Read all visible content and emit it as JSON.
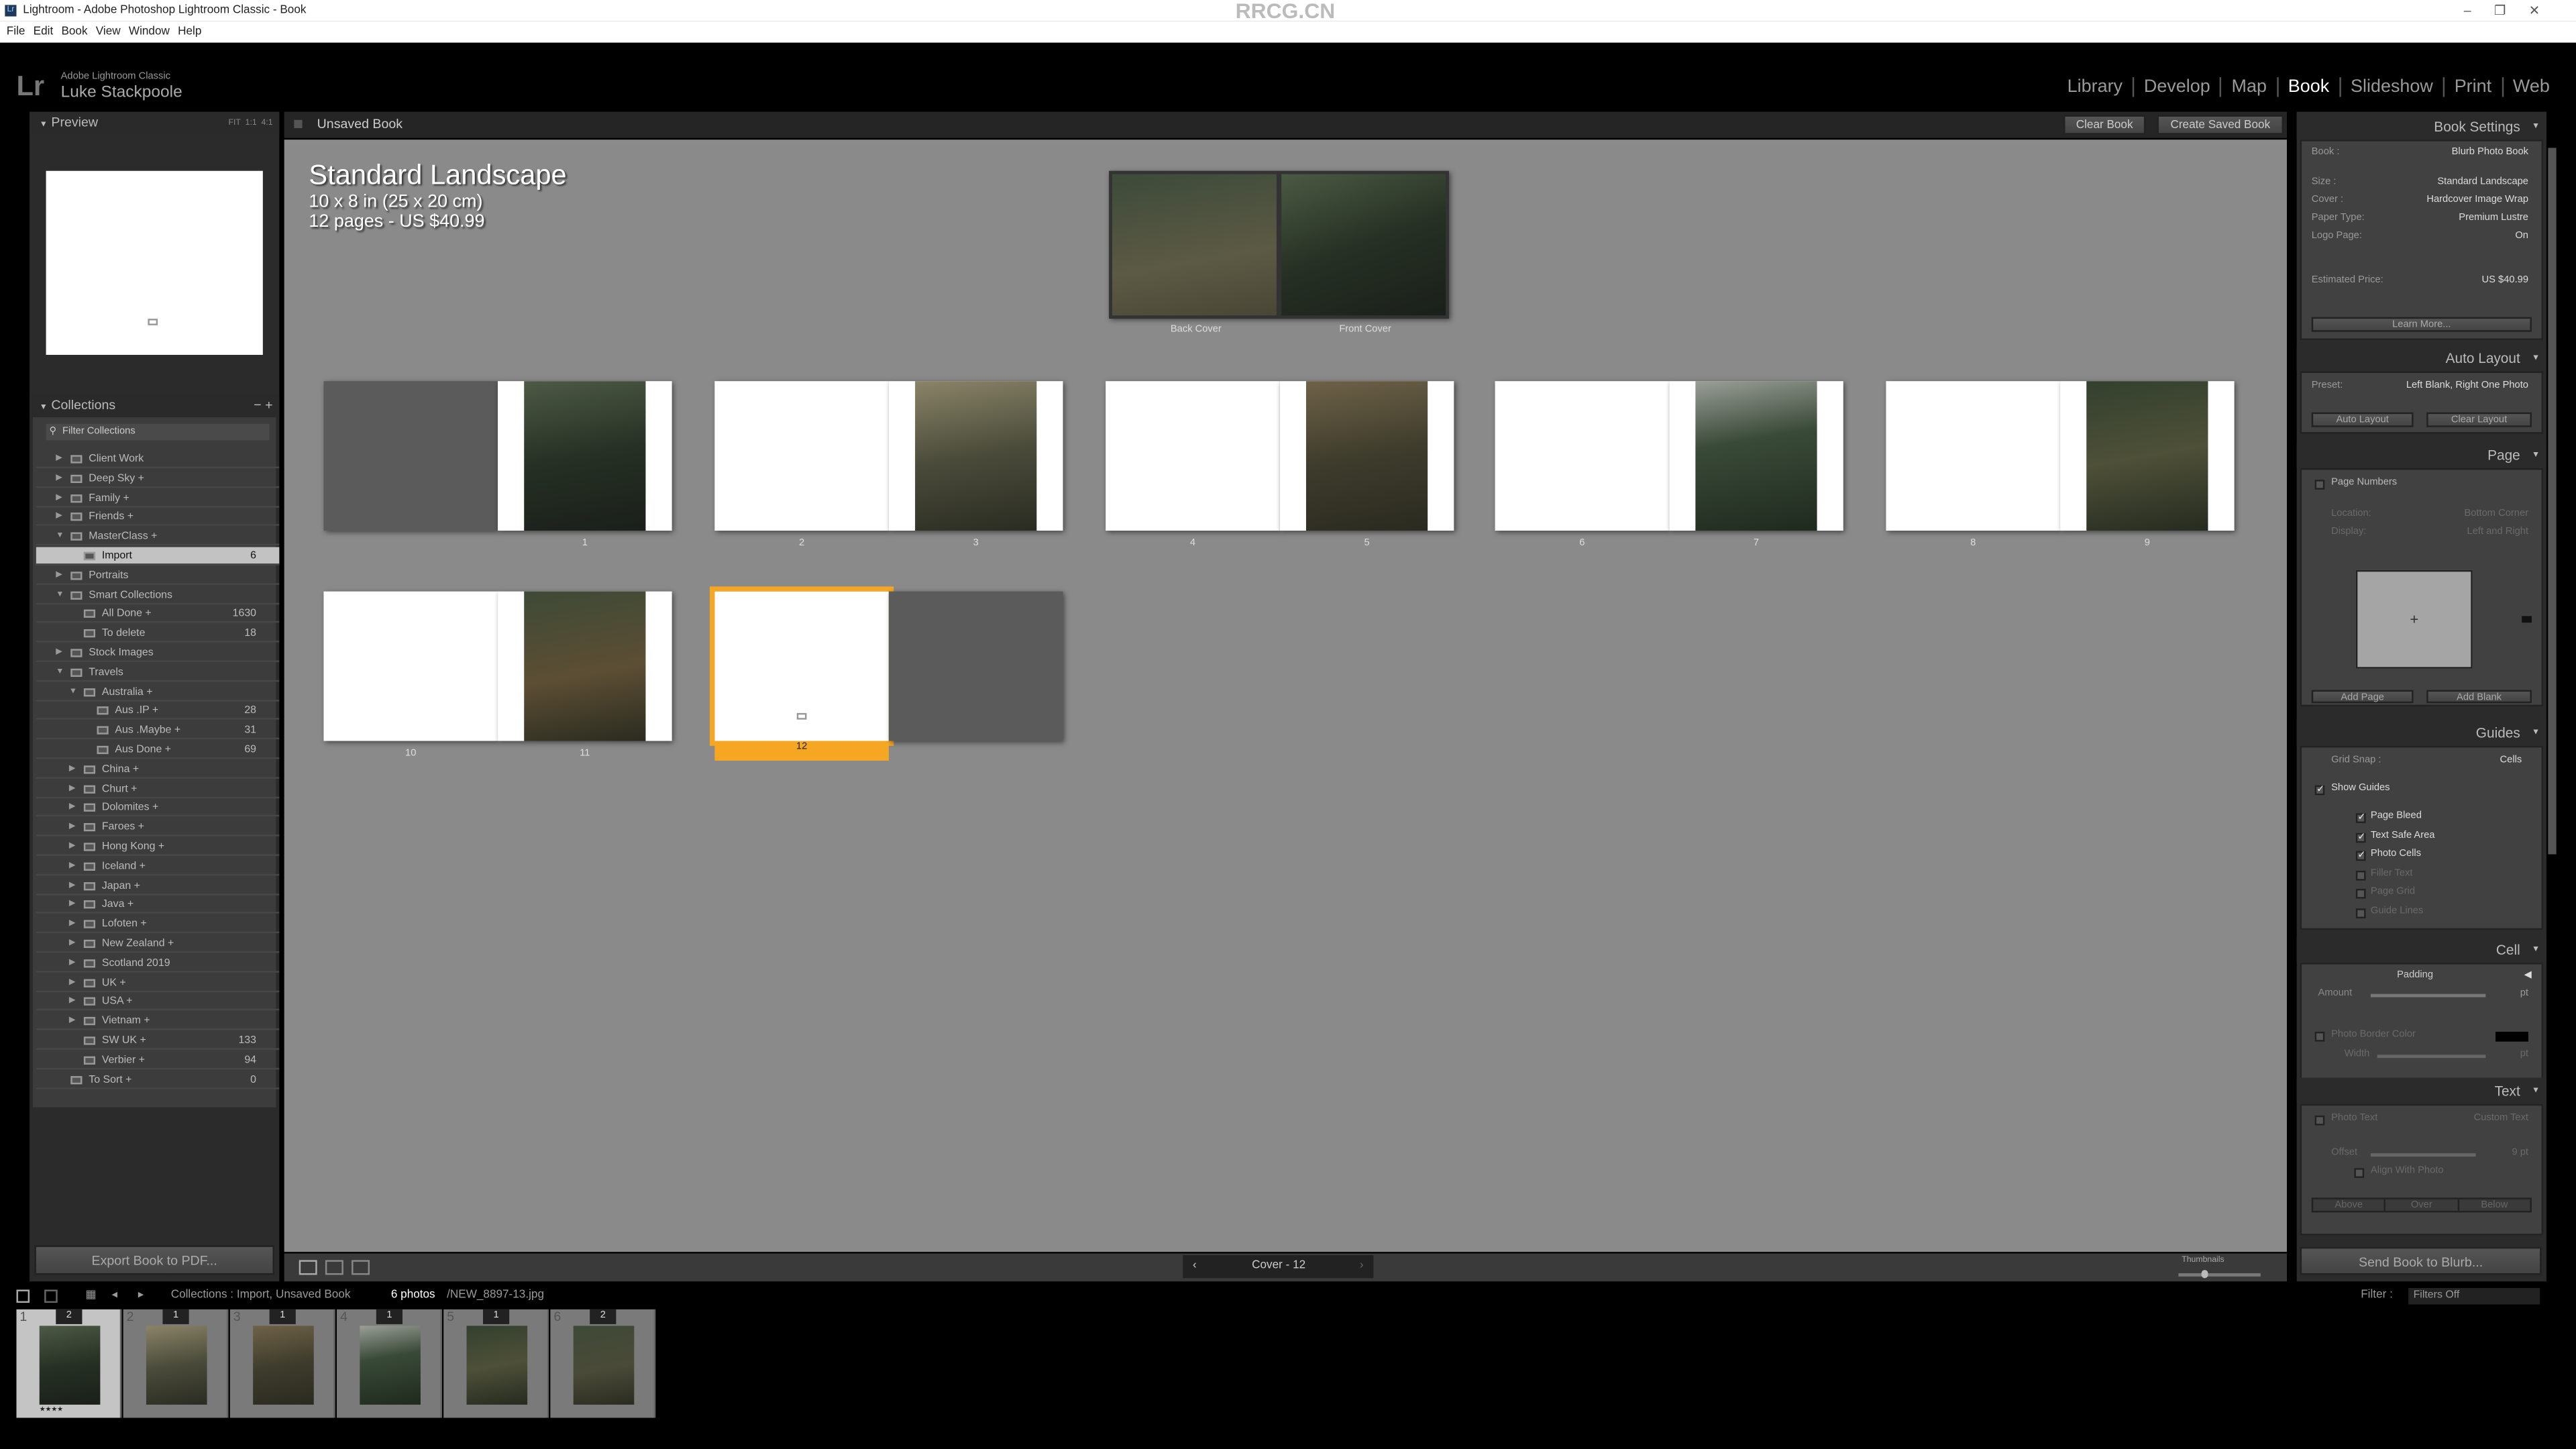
{
  "window": {
    "title": "Lightroom - Adobe Photoshop Lightroom Classic - Book",
    "app_icon": "Lr",
    "controls": [
      "–",
      "❐",
      "✕"
    ]
  },
  "watermark": "RRCG.CN",
  "menu": [
    "File",
    "Edit",
    "Book",
    "View",
    "Window",
    "Help"
  ],
  "identity": {
    "logo": "Lr",
    "product": "Adobe Lightroom Classic",
    "user": "Luke Stackpoole"
  },
  "modules": [
    {
      "label": "Library"
    },
    {
      "label": "Develop"
    },
    {
      "label": "Map"
    },
    {
      "label": "Book",
      "active": true
    },
    {
      "label": "Slideshow"
    },
    {
      "label": "Print"
    },
    {
      "label": "Web"
    }
  ],
  "left": {
    "preview": {
      "title": "Preview",
      "zoom": [
        "FIT",
        "1:1",
        "4:1"
      ]
    },
    "collections": {
      "title": "Collections",
      "minus": "−",
      "plus": "+",
      "filter": "Filter Collections",
      "items": [
        {
          "label": "Client Work",
          "depth": 0,
          "toggle": "▶",
          "type": "set"
        },
        {
          "label": "Deep Sky +",
          "depth": 0,
          "toggle": "▶",
          "type": "set"
        },
        {
          "label": "Family +",
          "depth": 0,
          "toggle": "▶",
          "type": "set"
        },
        {
          "label": "Friends +",
          "depth": 0,
          "toggle": "▶",
          "type": "set"
        },
        {
          "label": "MasterClass +",
          "depth": 0,
          "toggle": "▼",
          "type": "set"
        },
        {
          "label": "Import",
          "depth": 1,
          "toggle": "",
          "type": "collection",
          "count": "6",
          "selected": true
        },
        {
          "label": "Portraits",
          "depth": 0,
          "toggle": "▶",
          "type": "set"
        },
        {
          "label": "Smart Collections",
          "depth": 0,
          "toggle": "▼",
          "type": "set"
        },
        {
          "label": "All Done +",
          "depth": 1,
          "toggle": "",
          "type": "smart",
          "count": "1630"
        },
        {
          "label": "To delete",
          "depth": 1,
          "toggle": "",
          "type": "smart",
          "count": "18"
        },
        {
          "label": "Stock Images",
          "depth": 0,
          "toggle": "▶",
          "type": "set"
        },
        {
          "label": "Travels",
          "depth": 0,
          "toggle": "▼",
          "type": "set"
        },
        {
          "label": "Australia +",
          "depth": 1,
          "toggle": "▼",
          "type": "set"
        },
        {
          "label": "Aus .IP +",
          "depth": 2,
          "toggle": "",
          "type": "collection",
          "count": "28"
        },
        {
          "label": "Aus .Maybe +",
          "depth": 2,
          "toggle": "",
          "type": "collection",
          "count": "31"
        },
        {
          "label": "Aus Done +",
          "depth": 2,
          "toggle": "",
          "type": "collection",
          "count": "69"
        },
        {
          "label": "China +",
          "depth": 1,
          "toggle": "▶",
          "type": "set"
        },
        {
          "label": "Churt +",
          "depth": 1,
          "toggle": "▶",
          "type": "set"
        },
        {
          "label": "Dolomites +",
          "depth": 1,
          "toggle": "▶",
          "type": "set"
        },
        {
          "label": "Faroes +",
          "depth": 1,
          "toggle": "▶",
          "type": "set"
        },
        {
          "label": "Hong Kong +",
          "depth": 1,
          "toggle": "▶",
          "type": "set"
        },
        {
          "label": "Iceland +",
          "depth": 1,
          "toggle": "▶",
          "type": "set"
        },
        {
          "label": "Japan +",
          "depth": 1,
          "toggle": "▶",
          "type": "set"
        },
        {
          "label": "Java +",
          "depth": 1,
          "toggle": "▶",
          "type": "set"
        },
        {
          "label": "Lofoten +",
          "depth": 1,
          "toggle": "▶",
          "type": "set"
        },
        {
          "label": "New Zealand +",
          "depth": 1,
          "toggle": "▶",
          "type": "set"
        },
        {
          "label": "Scotland 2019",
          "depth": 1,
          "toggle": "▶",
          "type": "set"
        },
        {
          "label": "UK +",
          "depth": 1,
          "toggle": "▶",
          "type": "set"
        },
        {
          "label": "USA +",
          "depth": 1,
          "toggle": "▶",
          "type": "set"
        },
        {
          "label": "Vietnam +",
          "depth": 1,
          "toggle": "▶",
          "type": "set"
        },
        {
          "label": "SW UK +",
          "depth": 1,
          "toggle": "",
          "type": "collection",
          "count": "133"
        },
        {
          "label": "Verbier +",
          "depth": 1,
          "toggle": "",
          "type": "collection",
          "count": "94"
        },
        {
          "label": "To Sort +",
          "depth": 0,
          "toggle": "",
          "type": "collection",
          "count": "0"
        }
      ]
    },
    "export_button": "Export Book to PDF..."
  },
  "center": {
    "title": "Unsaved Book",
    "clear_book": "Clear Book",
    "create_saved_book": "Create Saved Book",
    "book_info": {
      "size": "Standard Landscape",
      "dimensions": "10 x 8 in (25 x 20 cm)",
      "pages_price": "12 pages - US $40.99"
    },
    "cover": {
      "back": "Back Cover",
      "front": "Front Cover"
    },
    "spreads": [
      {
        "left": "",
        "right": "1",
        "left_blank_dark": true
      },
      {
        "left": "2",
        "right": "3"
      },
      {
        "left": "4",
        "right": "5"
      },
      {
        "left": "6",
        "right": "7"
      },
      {
        "left": "8",
        "right": "9"
      },
      {
        "left": "10",
        "right": "11"
      },
      {
        "left": "12",
        "right": "",
        "selected": "left",
        "right_blank_dark": true
      }
    ],
    "selection_color": "#f5a623",
    "page_nav": {
      "prev": "‹",
      "label": "Cover - 12",
      "next": "›"
    },
    "thumbnails_label": "Thumbnails",
    "thumbnails_level": 0.3
  },
  "right": {
    "book_settings": {
      "title": "Book Settings",
      "rows": [
        {
          "label": "Book :",
          "value": "Blurb Photo Book"
        },
        {
          "label": "Size :",
          "value": "Standard Landscape"
        },
        {
          "label": "Cover :",
          "value": "Hardcover Image Wrap"
        },
        {
          "label": "Paper Type:",
          "value": "Premium Lustre"
        },
        {
          "label": "Logo Page:",
          "value": "On"
        },
        {
          "label": "Estimated Price:",
          "value": "US $40.99"
        }
      ],
      "learn_more": "Learn More..."
    },
    "auto_layout": {
      "title": "Auto Layout",
      "preset_label": "Preset:",
      "preset_value": "Left Blank, Right One Photo",
      "auto_layout": "Auto Layout",
      "clear_layout": "Clear Layout"
    },
    "page": {
      "title": "Page",
      "page_numbers": "Page Numbers",
      "page_numbers_checked": false,
      "location_label": "Location:",
      "location_value": "Bottom Corner",
      "display_label": "Display:",
      "display_value": "Left and Right",
      "add_page": "Add Page",
      "add_blank": "Add Blank"
    },
    "guides": {
      "title": "Guides",
      "grid_snap_label": "Grid Snap :",
      "grid_snap_value": "Cells",
      "show_guides": "Show Guides",
      "show_guides_checked": true,
      "options": [
        {
          "label": "Page Bleed",
          "checked": true
        },
        {
          "label": "Text Safe Area",
          "checked": true
        },
        {
          "label": "Photo Cells",
          "checked": true
        },
        {
          "label": "Filler Text",
          "checked": false
        },
        {
          "label": "Page Grid",
          "checked": false
        },
        {
          "label": "Guide Lines",
          "checked": false
        }
      ]
    },
    "cell": {
      "title": "Cell",
      "padding": "Padding",
      "amount": "Amount",
      "unit": "pt",
      "photo_border_color": "Photo Border Color",
      "border_color": "#000000",
      "width": "Width"
    },
    "text": {
      "title": "Text",
      "photo_text": "Photo Text",
      "photo_text_value": "Custom Text",
      "offset": "Offset",
      "offset_value": "9 pt",
      "align_with_photo": "Align With Photo",
      "positions": [
        "Above",
        "Over",
        "Below"
      ]
    },
    "send_button": "Send Book to Blurb..."
  },
  "filmstrip": {
    "source": "Collections : Import, Unsaved Book",
    "count": "6 photos",
    "file": "/NEW_8897-13.jpg",
    "filter_label": "Filter :",
    "filter_value": "Filters Off",
    "photos": [
      {
        "index": "1",
        "uses": "2",
        "stars": "★★★★",
        "selected": true
      },
      {
        "index": "2",
        "uses": "1"
      },
      {
        "index": "3",
        "uses": "1"
      },
      {
        "index": "4",
        "uses": "1"
      },
      {
        "index": "5",
        "uses": "1"
      },
      {
        "index": "6",
        "uses": "2"
      }
    ]
  }
}
